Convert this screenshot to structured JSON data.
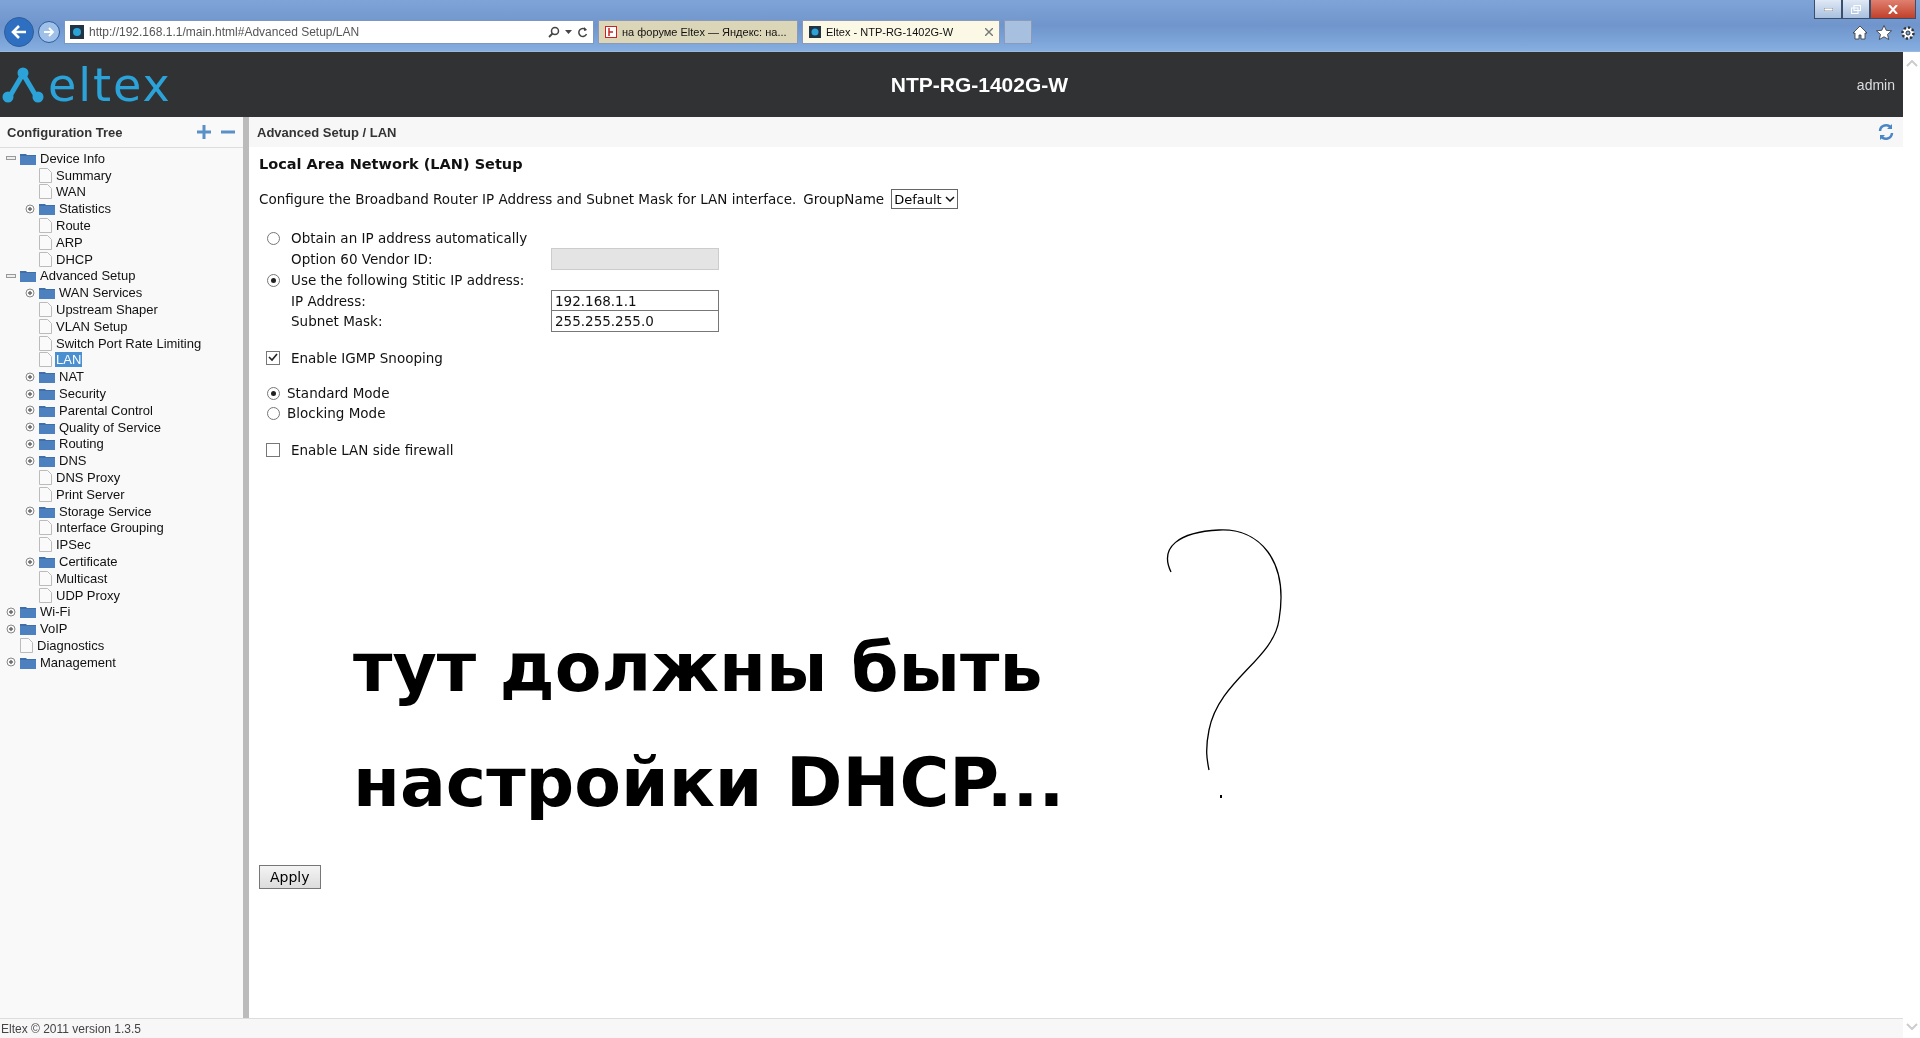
{
  "browser": {
    "url": "http://192.168.1.1/main.html#Advanced Setup/LAN",
    "tabs": [
      {
        "title": "на форуме Eltex — Яндекс: на...",
        "selected": false
      },
      {
        "title": "Eltex - NTP-RG-1402G-W",
        "selected": true
      }
    ]
  },
  "header": {
    "logo": "eltex",
    "title": "NTP-RG-1402G-W",
    "user": "admin"
  },
  "sidebar": {
    "title": "Configuration Tree",
    "tree": [
      {
        "label": "Device Info",
        "kind": "folder",
        "expanded": true,
        "selected": false,
        "children": [
          {
            "label": "Summary",
            "kind": "page",
            "selected": false
          },
          {
            "label": "WAN",
            "kind": "page",
            "selected": false
          },
          {
            "label": "Statistics",
            "kind": "folder",
            "expanded": false,
            "selected": false
          },
          {
            "label": "Route",
            "kind": "page",
            "selected": false
          },
          {
            "label": "ARP",
            "kind": "page",
            "selected": false
          },
          {
            "label": "DHCP",
            "kind": "page",
            "selected": false
          }
        ]
      },
      {
        "label": "Advanced Setup",
        "kind": "folder",
        "expanded": true,
        "selected": false,
        "children": [
          {
            "label": "WAN Services",
            "kind": "folder",
            "expanded": false,
            "selected": false
          },
          {
            "label": "Upstream Shaper",
            "kind": "page",
            "selected": false
          },
          {
            "label": "VLAN Setup",
            "kind": "page",
            "selected": false
          },
          {
            "label": "Switch Port Rate Limiting",
            "kind": "page",
            "selected": false
          },
          {
            "label": "LAN",
            "kind": "page",
            "selected": true
          },
          {
            "label": "NAT",
            "kind": "folder",
            "expanded": false,
            "selected": false
          },
          {
            "label": "Security",
            "kind": "folder",
            "expanded": false,
            "selected": false
          },
          {
            "label": "Parental Control",
            "kind": "folder",
            "expanded": false,
            "selected": false
          },
          {
            "label": "Quality of Service",
            "kind": "folder",
            "expanded": false,
            "selected": false
          },
          {
            "label": "Routing",
            "kind": "folder",
            "expanded": false,
            "selected": false
          },
          {
            "label": "DNS",
            "kind": "folder",
            "expanded": false,
            "selected": false
          },
          {
            "label": "DNS Proxy",
            "kind": "page",
            "selected": false
          },
          {
            "label": "Print Server",
            "kind": "page",
            "selected": false
          },
          {
            "label": "Storage Service",
            "kind": "folder",
            "expanded": false,
            "selected": false
          },
          {
            "label": "Interface Grouping",
            "kind": "page",
            "selected": false
          },
          {
            "label": "IPSec",
            "kind": "page",
            "selected": false
          },
          {
            "label": "Certificate",
            "kind": "folder",
            "expanded": false,
            "selected": false
          },
          {
            "label": "Multicast",
            "kind": "page",
            "selected": false
          },
          {
            "label": "UDP Proxy",
            "kind": "page",
            "selected": false
          }
        ]
      },
      {
        "label": "Wi-Fi",
        "kind": "folder",
        "expanded": false,
        "selected": false
      },
      {
        "label": "VoIP",
        "kind": "folder",
        "expanded": false,
        "selected": false
      },
      {
        "label": "Diagnostics",
        "kind": "page",
        "selected": false
      },
      {
        "label": "Management",
        "kind": "folder",
        "expanded": false,
        "selected": false
      }
    ]
  },
  "main": {
    "breadcrumb": "Advanced Setup / LAN",
    "heading": "Local Area Network (LAN) Setup",
    "description": "Configure the Broadband Router IP Address and Subnet Mask for LAN interface.",
    "group_label": "GroupName",
    "group_value": "Default",
    "ip_modes": [
      {
        "label": "Obtain an IP address automatically",
        "selected": false,
        "fields": [
          {
            "label": "Option 60 Vendor ID:",
            "disabled": true
          }
        ]
      },
      {
        "label": "Use the following Stitic IP address:",
        "selected": true,
        "fields": [
          {
            "label": "IP Address:",
            "value": "192.168.1.1",
            "disabled": false
          },
          {
            "label": "Subnet Mask:",
            "value": "255.255.255.0",
            "disabled": false
          }
        ]
      }
    ],
    "igmp": {
      "label": "Enable IGMP Snooping",
      "checked": true
    },
    "igmp_modes": [
      {
        "label": "Standard Mode",
        "selected": true
      },
      {
        "label": "Blocking Mode",
        "selected": false
      }
    ],
    "firewall": {
      "label": "Enable LAN side firewall",
      "checked": false
    },
    "annotation": [
      "тут должны быть",
      "настройки DHCP..."
    ],
    "apply": "Apply"
  },
  "footer": "Eltex © 2011 version 1.3.5"
}
